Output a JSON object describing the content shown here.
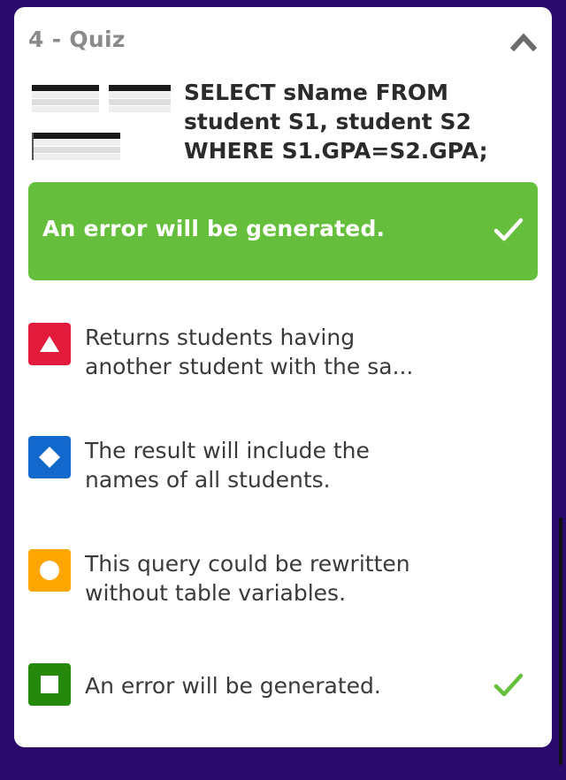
{
  "quiz": {
    "title": "4 - Quiz",
    "collapse_icon": "chevron-up-icon"
  },
  "question": {
    "text": "SELECT sName FROM student S1, student S2 WHERE S1.GPA=S2.GPA;"
  },
  "correct_answer": {
    "text": "An error will be generated.",
    "icon": "checkmark-icon",
    "color": "#66bf3c"
  },
  "options": [
    {
      "text": "Returns students having\nanother student with the sa...",
      "icon": "triangle-icon",
      "color": "#e21b3c"
    },
    {
      "text": "The result will include the\nnames of all students.",
      "icon": "diamond-icon",
      "color": "#1368ce"
    },
    {
      "text": "This query could be rewritten\nwithout table variables.",
      "icon": "circle-icon",
      "color": "#ffa602"
    },
    {
      "text": "An error will be generated.",
      "icon": "square-icon",
      "color": "#26890c",
      "correct": true
    }
  ],
  "colors": {
    "background": "#2a0a6b",
    "check": "#66bf3c"
  }
}
